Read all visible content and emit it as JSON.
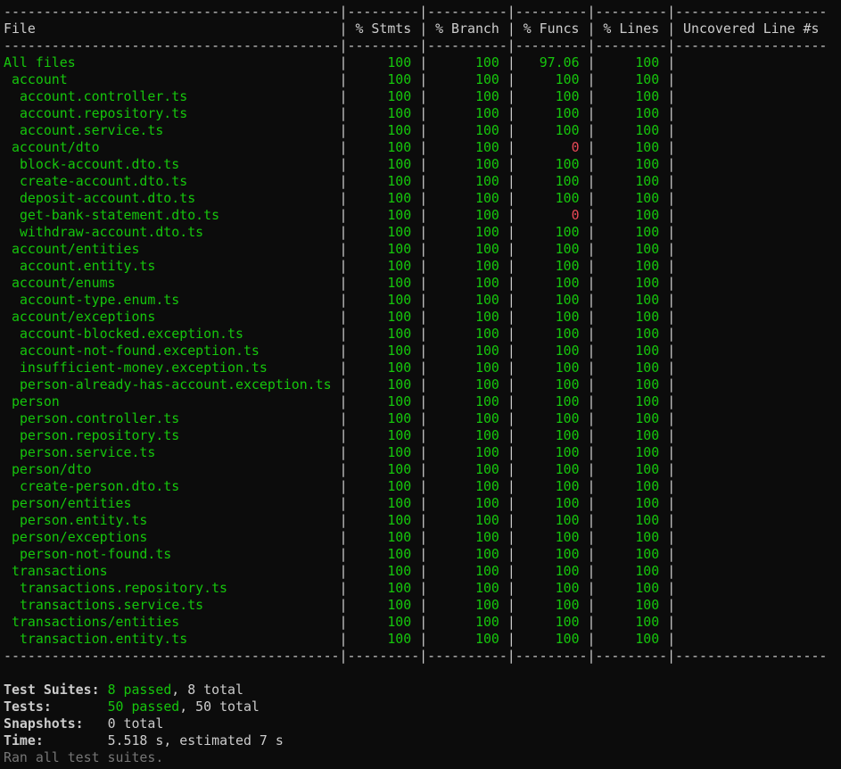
{
  "colors": {
    "background": "#0c0c0c",
    "text": "#cccccc",
    "covered": "#16c60c",
    "uncovered": "#e74856",
    "dim": "#767676"
  },
  "coverage": {
    "columns": [
      "File",
      "% Stmts",
      "% Branch",
      "% Funcs",
      "% Lines",
      "Uncovered Line #s"
    ],
    "rows": [
      {
        "file": "All files",
        "level": 0,
        "stmts": "100",
        "branch": "100",
        "funcs": "97.06",
        "lines": "100",
        "uncovered": ""
      },
      {
        "file": "account",
        "level": 1,
        "stmts": "100",
        "branch": "100",
        "funcs": "100",
        "lines": "100",
        "uncovered": ""
      },
      {
        "file": "account.controller.ts",
        "level": 2,
        "stmts": "100",
        "branch": "100",
        "funcs": "100",
        "lines": "100",
        "uncovered": ""
      },
      {
        "file": "account.repository.ts",
        "level": 2,
        "stmts": "100",
        "branch": "100",
        "funcs": "100",
        "lines": "100",
        "uncovered": ""
      },
      {
        "file": "account.service.ts",
        "level": 2,
        "stmts": "100",
        "branch": "100",
        "funcs": "100",
        "lines": "100",
        "uncovered": ""
      },
      {
        "file": "account/dto",
        "level": 1,
        "stmts": "100",
        "branch": "100",
        "funcs": "0",
        "lines": "100",
        "uncovered": ""
      },
      {
        "file": "block-account.dto.ts",
        "level": 2,
        "stmts": "100",
        "branch": "100",
        "funcs": "100",
        "lines": "100",
        "uncovered": ""
      },
      {
        "file": "create-account.dto.ts",
        "level": 2,
        "stmts": "100",
        "branch": "100",
        "funcs": "100",
        "lines": "100",
        "uncovered": ""
      },
      {
        "file": "deposit-account.dto.ts",
        "level": 2,
        "stmts": "100",
        "branch": "100",
        "funcs": "100",
        "lines": "100",
        "uncovered": ""
      },
      {
        "file": "get-bank-statement.dto.ts",
        "level": 2,
        "stmts": "100",
        "branch": "100",
        "funcs": "0",
        "lines": "100",
        "uncovered": ""
      },
      {
        "file": "withdraw-account.dto.ts",
        "level": 2,
        "stmts": "100",
        "branch": "100",
        "funcs": "100",
        "lines": "100",
        "uncovered": ""
      },
      {
        "file": "account/entities",
        "level": 1,
        "stmts": "100",
        "branch": "100",
        "funcs": "100",
        "lines": "100",
        "uncovered": ""
      },
      {
        "file": "account.entity.ts",
        "level": 2,
        "stmts": "100",
        "branch": "100",
        "funcs": "100",
        "lines": "100",
        "uncovered": ""
      },
      {
        "file": "account/enums",
        "level": 1,
        "stmts": "100",
        "branch": "100",
        "funcs": "100",
        "lines": "100",
        "uncovered": ""
      },
      {
        "file": "account-type.enum.ts",
        "level": 2,
        "stmts": "100",
        "branch": "100",
        "funcs": "100",
        "lines": "100",
        "uncovered": ""
      },
      {
        "file": "account/exceptions",
        "level": 1,
        "stmts": "100",
        "branch": "100",
        "funcs": "100",
        "lines": "100",
        "uncovered": ""
      },
      {
        "file": "account-blocked.exception.ts",
        "level": 2,
        "stmts": "100",
        "branch": "100",
        "funcs": "100",
        "lines": "100",
        "uncovered": ""
      },
      {
        "file": "account-not-found.exception.ts",
        "level": 2,
        "stmts": "100",
        "branch": "100",
        "funcs": "100",
        "lines": "100",
        "uncovered": ""
      },
      {
        "file": "insufficient-money.exception.ts",
        "level": 2,
        "stmts": "100",
        "branch": "100",
        "funcs": "100",
        "lines": "100",
        "uncovered": ""
      },
      {
        "file": "person-already-has-account.exception.ts",
        "level": 2,
        "stmts": "100",
        "branch": "100",
        "funcs": "100",
        "lines": "100",
        "uncovered": ""
      },
      {
        "file": "person",
        "level": 1,
        "stmts": "100",
        "branch": "100",
        "funcs": "100",
        "lines": "100",
        "uncovered": ""
      },
      {
        "file": "person.controller.ts",
        "level": 2,
        "stmts": "100",
        "branch": "100",
        "funcs": "100",
        "lines": "100",
        "uncovered": ""
      },
      {
        "file": "person.repository.ts",
        "level": 2,
        "stmts": "100",
        "branch": "100",
        "funcs": "100",
        "lines": "100",
        "uncovered": ""
      },
      {
        "file": "person.service.ts",
        "level": 2,
        "stmts": "100",
        "branch": "100",
        "funcs": "100",
        "lines": "100",
        "uncovered": ""
      },
      {
        "file": "person/dto",
        "level": 1,
        "stmts": "100",
        "branch": "100",
        "funcs": "100",
        "lines": "100",
        "uncovered": ""
      },
      {
        "file": "create-person.dto.ts",
        "level": 2,
        "stmts": "100",
        "branch": "100",
        "funcs": "100",
        "lines": "100",
        "uncovered": ""
      },
      {
        "file": "person/entities",
        "level": 1,
        "stmts": "100",
        "branch": "100",
        "funcs": "100",
        "lines": "100",
        "uncovered": ""
      },
      {
        "file": "person.entity.ts",
        "level": 2,
        "stmts": "100",
        "branch": "100",
        "funcs": "100",
        "lines": "100",
        "uncovered": ""
      },
      {
        "file": "person/exceptions",
        "level": 1,
        "stmts": "100",
        "branch": "100",
        "funcs": "100",
        "lines": "100",
        "uncovered": ""
      },
      {
        "file": "person-not-found.ts",
        "level": 2,
        "stmts": "100",
        "branch": "100",
        "funcs": "100",
        "lines": "100",
        "uncovered": ""
      },
      {
        "file": "transactions",
        "level": 1,
        "stmts": "100",
        "branch": "100",
        "funcs": "100",
        "lines": "100",
        "uncovered": ""
      },
      {
        "file": "transactions.repository.ts",
        "level": 2,
        "stmts": "100",
        "branch": "100",
        "funcs": "100",
        "lines": "100",
        "uncovered": ""
      },
      {
        "file": "transactions.service.ts",
        "level": 2,
        "stmts": "100",
        "branch": "100",
        "funcs": "100",
        "lines": "100",
        "uncovered": ""
      },
      {
        "file": "transactions/entities",
        "level": 1,
        "stmts": "100",
        "branch": "100",
        "funcs": "100",
        "lines": "100",
        "uncovered": ""
      },
      {
        "file": "transaction.entity.ts",
        "level": 2,
        "stmts": "100",
        "branch": "100",
        "funcs": "100",
        "lines": "100",
        "uncovered": ""
      }
    ]
  },
  "summary": [
    {
      "label": "Test Suites:",
      "passed": "8 passed",
      "rest": ", 8 total"
    },
    {
      "label": "Tests:",
      "passed": "50 passed",
      "rest": ", 50 total"
    },
    {
      "label": "Snapshots:",
      "passed": "",
      "rest": "0 total"
    },
    {
      "label": "Time:",
      "passed": "",
      "rest": "5.518 s, estimated 7 s"
    }
  ],
  "footer": "Ran all test suites."
}
